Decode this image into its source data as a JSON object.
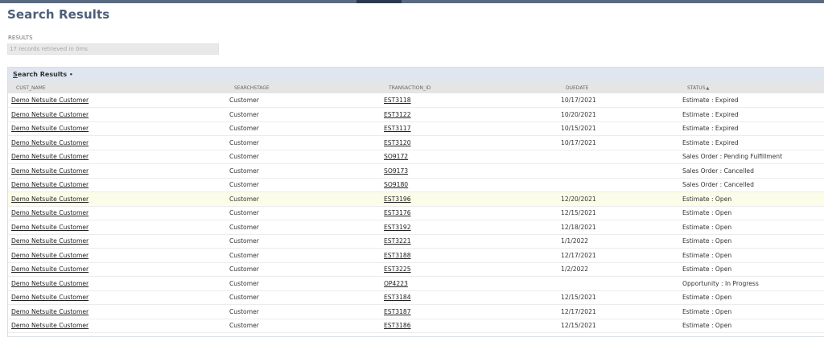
{
  "page": {
    "title": "Search Results"
  },
  "results_summary": {
    "label": "RESULTS",
    "text": "17 records retrieved in 0ms"
  },
  "panel": {
    "title_prefix": "S",
    "title_rest": "earch Results",
    "title_suffix": "•"
  },
  "columns": [
    "CUST_NAME",
    "SEARCHSTAGE",
    "TRANSACTION_ID",
    "DUEDATE",
    "STATUS"
  ],
  "sort_indicator": "▲",
  "rows": [
    {
      "cust_name": "Demo Netsuite Customer",
      "searchstage": "Customer",
      "transaction_id": "EST3118",
      "duedate": "10/17/2021",
      "status": "Estimate : Expired"
    },
    {
      "cust_name": "Demo Netsuite Customer",
      "searchstage": "Customer",
      "transaction_id": "EST3122",
      "duedate": "10/20/2021",
      "status": "Estimate : Expired"
    },
    {
      "cust_name": "Demo Netsuite Customer",
      "searchstage": "Customer",
      "transaction_id": "EST3117",
      "duedate": "10/15/2021",
      "status": "Estimate : Expired"
    },
    {
      "cust_name": "Demo Netsuite Customer",
      "searchstage": "Customer",
      "transaction_id": "EST3120",
      "duedate": "10/17/2021",
      "status": "Estimate : Expired"
    },
    {
      "cust_name": "Demo Netsuite Customer",
      "searchstage": "Customer",
      "transaction_id": "SO9172",
      "duedate": "",
      "status": "Sales Order : Pending Fulfillment"
    },
    {
      "cust_name": "Demo Netsuite Customer",
      "searchstage": "Customer",
      "transaction_id": "SO9173",
      "duedate": "",
      "status": "Sales Order : Cancelled"
    },
    {
      "cust_name": "Demo Netsuite Customer",
      "searchstage": "Customer",
      "transaction_id": "SO9180",
      "duedate": "",
      "status": "Sales Order : Cancelled"
    },
    {
      "cust_name": "Demo Netsuite Customer",
      "searchstage": "Customer",
      "transaction_id": "EST3196",
      "duedate": "12/20/2021",
      "status": "Estimate : Open"
    },
    {
      "cust_name": "Demo Netsuite Customer",
      "searchstage": "Customer",
      "transaction_id": "EST3176",
      "duedate": "12/15/2021",
      "status": "Estimate : Open"
    },
    {
      "cust_name": "Demo Netsuite Customer",
      "searchstage": "Customer",
      "transaction_id": "EST3192",
      "duedate": "12/18/2021",
      "status": "Estimate : Open"
    },
    {
      "cust_name": "Demo Netsuite Customer",
      "searchstage": "Customer",
      "transaction_id": "EST3221",
      "duedate": "1/1/2022",
      "status": "Estimate : Open"
    },
    {
      "cust_name": "Demo Netsuite Customer",
      "searchstage": "Customer",
      "transaction_id": "EST3188",
      "duedate": "12/17/2021",
      "status": "Estimate : Open"
    },
    {
      "cust_name": "Demo Netsuite Customer",
      "searchstage": "Customer",
      "transaction_id": "EST3225",
      "duedate": "1/2/2022",
      "status": "Estimate : Open"
    },
    {
      "cust_name": "Demo Netsuite Customer",
      "searchstage": "Customer",
      "transaction_id": "OP4223",
      "duedate": "",
      "status": "Opportunity : In Progress"
    },
    {
      "cust_name": "Demo Netsuite Customer",
      "searchstage": "Customer",
      "transaction_id": "EST3184",
      "duedate": "12/15/2021",
      "status": "Estimate : Open"
    },
    {
      "cust_name": "Demo Netsuite Customer",
      "searchstage": "Customer",
      "transaction_id": "EST3187",
      "duedate": "12/17/2021",
      "status": "Estimate : Open"
    },
    {
      "cust_name": "Demo Netsuite Customer",
      "searchstage": "Customer",
      "transaction_id": "EST3186",
      "duedate": "12/15/2021",
      "status": "Estimate : Open"
    }
  ]
}
